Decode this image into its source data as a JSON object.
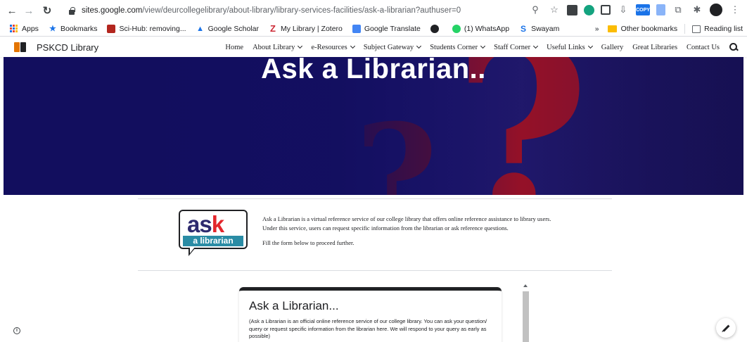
{
  "browser": {
    "url_host": "sites.google.com",
    "url_path": "/view/deurcollegelibrary/about-library/library-services-facilities/ask-a-librarian?authuser=0",
    "copy_badge": "COPY"
  },
  "bookmarks": {
    "items": [
      {
        "label": "Apps",
        "icon": "apps-grid-icon"
      },
      {
        "label": "Bookmarks",
        "icon": "star-icon"
      },
      {
        "label": "Sci-Hub: removing...",
        "icon": "scihub-icon"
      },
      {
        "label": "Google Scholar",
        "icon": "scholar-icon"
      },
      {
        "label": "My Library | Zotero",
        "icon": "zotero-icon"
      },
      {
        "label": "Google Translate",
        "icon": "translate-icon"
      },
      {
        "label": "",
        "icon": "chrome-circle-icon"
      },
      {
        "label": "(1) WhatsApp",
        "icon": "whatsapp-icon"
      },
      {
        "label": "Swayam",
        "icon": "swayam-icon"
      }
    ],
    "overflow": "»",
    "other": "Other bookmarks",
    "reading_list": "Reading list"
  },
  "site": {
    "title": "PSKCD Library",
    "nav": [
      {
        "label": "Home",
        "dropdown": false
      },
      {
        "label": "About Library",
        "dropdown": true
      },
      {
        "label": "e-Resources",
        "dropdown": true
      },
      {
        "label": "Subject Gateway",
        "dropdown": true
      },
      {
        "label": "Students Corner",
        "dropdown": true
      },
      {
        "label": "Staff Corner",
        "dropdown": true
      },
      {
        "label": "Useful Links",
        "dropdown": true
      },
      {
        "label": "Gallery",
        "dropdown": false
      },
      {
        "label": "Great Libraries",
        "dropdown": false
      },
      {
        "label": "Contact Us",
        "dropdown": false
      }
    ]
  },
  "hero": {
    "title": "Ask a Librarian..",
    "colors": {
      "background": "#1b1573",
      "accent": "#b5121a"
    }
  },
  "intro": {
    "logo_word_ask": "as",
    "logo_word_k": "k",
    "logo_sub": "a librarian",
    "paragraph1": "Ask a Librarian is a virtual reference service of our college library that offers online reference assistance to library users. Under this service, users can request specific information from the librarian or ask reference questions.",
    "paragraph2": "Fill the form below to proceed further."
  },
  "form": {
    "title": "Ask a Librarian...",
    "description": "(Ask a Librarian is an official online reference service of our college library. You can ask your question/ query or request specific information from the librarian here. We will respond to your query as early as possible)"
  },
  "icons": {
    "question_mark": "?",
    "info": "i"
  }
}
